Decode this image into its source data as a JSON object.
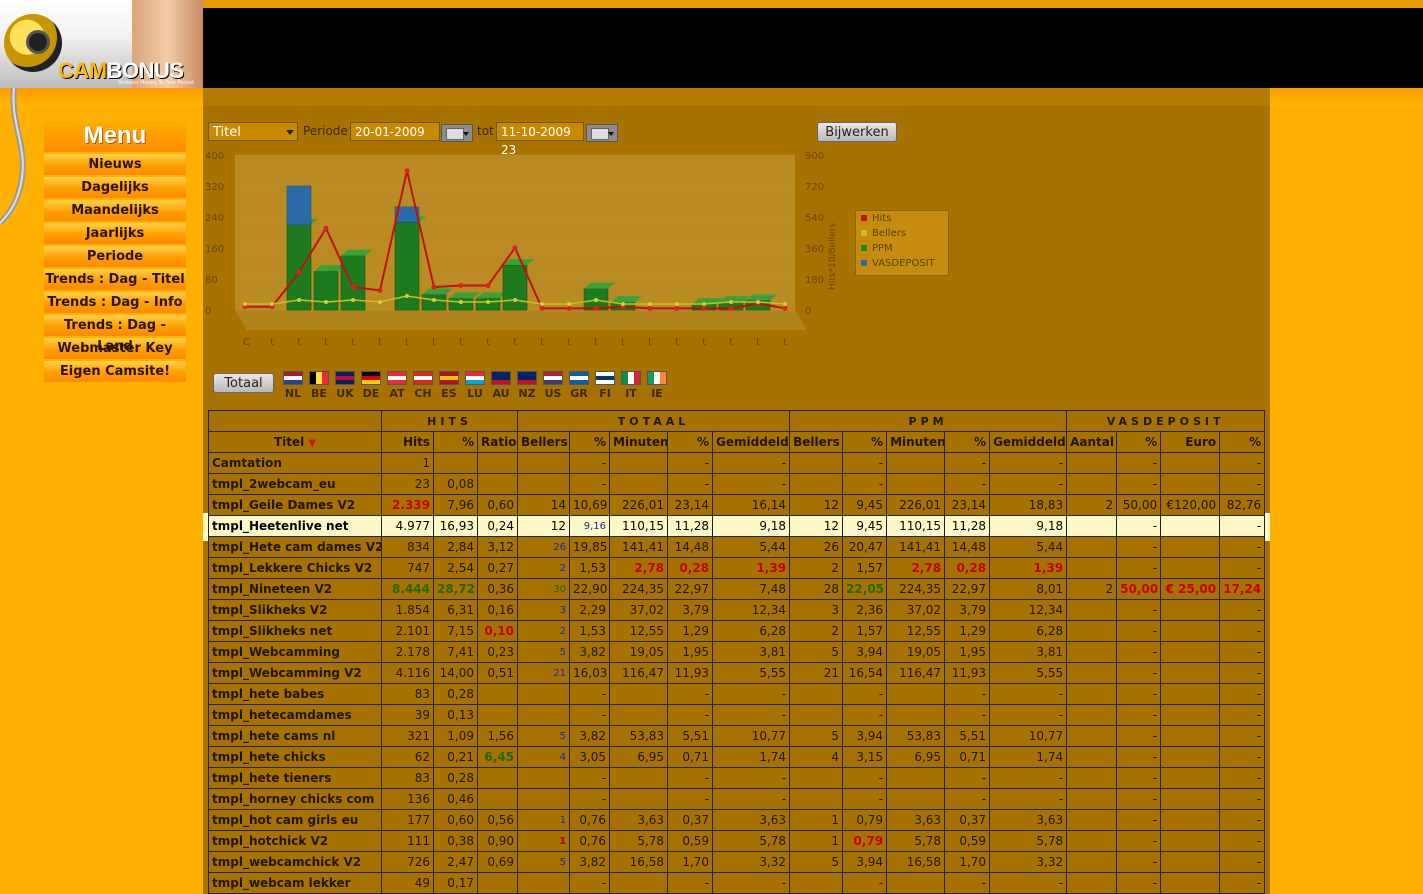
{
  "logo": {
    "brand_a": "CAM",
    "brand_b": "BONUS",
    "tagline": "Streams Money To Your Pocket"
  },
  "menu": {
    "title": "Menu",
    "items": [
      {
        "label": "Nieuws"
      },
      {
        "label": "Dagelijks"
      },
      {
        "label": "Maandelijks"
      },
      {
        "label": "Jaarlijks"
      },
      {
        "label": "Periode"
      },
      {
        "label": "Trends : Dag - Titel"
      },
      {
        "label": "Trends : Dag - Info"
      },
      {
        "label": "Trends : Dag - Land"
      },
      {
        "label": "Webmaster Key"
      },
      {
        "label": "Eigen Camsite!"
      }
    ]
  },
  "filters": {
    "select_value": "Titel",
    "periode_label": "Periode",
    "from_value": "20-01-2009",
    "tot_label": "tot",
    "to_value": "11-10-2009 23",
    "update_label": "Bijwerken",
    "total_label": "Totaal"
  },
  "colors": {
    "hits": "#C01010",
    "bellers": "#C8C020",
    "ppm": "#1E8A1E",
    "vasdeposit": "#2A6AA8"
  },
  "chart_data": {
    "type": "bar",
    "left_ticks": [
      "400",
      "320",
      "240",
      "160",
      "80",
      "0"
    ],
    "right_ticks": [
      "900",
      "720",
      "540",
      "360",
      "180",
      "0"
    ],
    "right_axis_label": "Hits*10/Bellers",
    "x_labels": [
      "C",
      "t",
      "t",
      "t",
      "t",
      "t",
      "t",
      "t",
      "t",
      "t",
      "t",
      "t",
      "t",
      "t",
      "t",
      "t",
      "t",
      "t",
      "t",
      "t",
      "t"
    ],
    "legend": [
      "Hits",
      "Bellers",
      "PPM",
      "VASDEPOSIT"
    ],
    "hits_line": [
      2,
      2,
      23,
      50,
      14,
      12,
      85,
      14,
      15,
      15,
      38,
      1,
      1,
      1,
      2,
      1,
      1,
      1,
      1,
      4,
      1
    ],
    "bellers_line": [
      0,
      0,
      2,
      1,
      2,
      1,
      4,
      2,
      1,
      1,
      2,
      0,
      0,
      2,
      0,
      0,
      0,
      0,
      1,
      1,
      0
    ],
    "ppm_bars": [
      0,
      0,
      220,
      100,
      140,
      0,
      226,
      40,
      30,
      30,
      116,
      0,
      0,
      55,
      20,
      0,
      0,
      15,
      20,
      25,
      0
    ],
    "vas_bars": [
      0,
      0,
      100,
      0,
      0,
      0,
      40,
      0,
      0,
      0,
      0,
      0,
      0,
      0,
      0,
      0,
      0,
      0,
      0,
      0,
      0
    ]
  },
  "countries": [
    "NL",
    "BE",
    "UK",
    "DE",
    "AT",
    "CH",
    "ES",
    "LU",
    "AU",
    "NZ",
    "US",
    "GR",
    "FI",
    "IT",
    "IE"
  ],
  "table": {
    "groups": [
      "HITS",
      "TOTAAL",
      "PPM",
      "VASDEPOSIT"
    ],
    "titel_header": "Titel",
    "columns": [
      "Hits",
      "%",
      "Ratio",
      "Bellers",
      "%",
      "Minuten",
      "%",
      "Gemiddeld",
      "Bellers",
      "%",
      "Minuten",
      "%",
      "Gemiddeld",
      "Aantal",
      "%",
      "Euro",
      "%"
    ],
    "rows": [
      {
        "name": "Camtation",
        "c": [
          "1",
          "",
          "",
          "",
          "-",
          "",
          "-",
          "-",
          "",
          "-",
          "",
          "-",
          "-",
          "",
          "-",
          "",
          "-"
        ]
      },
      {
        "name": "tmpl_2webcam_eu",
        "c": [
          "23",
          "0,08",
          "",
          "",
          "-",
          "",
          "-",
          "-",
          "",
          "-",
          "",
          "-",
          "-",
          "",
          "-",
          "",
          "-"
        ]
      },
      {
        "name": "tmpl_Geile Dames V2",
        "c": [
          "2.339",
          "7,96",
          "0,60",
          "14",
          "10,69",
          "226,01",
          "23,14",
          "16,14",
          "12",
          "9,45",
          "226,01",
          "23,14",
          "18,83",
          "2",
          "50,00",
          "€120,00",
          "82,76"
        ]
      },
      {
        "name": "tmpl_Heetenlive net",
        "c": [
          "4.977",
          "16,93",
          "0,24",
          "12",
          "9,16",
          "110,15",
          "11,28",
          "9,18",
          "12",
          "9,45",
          "110,15",
          "11,28",
          "9,18",
          "",
          "-",
          "",
          "-"
        ]
      },
      {
        "name": "tmpl_Hete cam dames V2",
        "c": [
          "834",
          "2,84",
          "3,12",
          "26",
          "19,85",
          "141,41",
          "14,48",
          "5,44",
          "26",
          "20,47",
          "141,41",
          "14,48",
          "5,44",
          "",
          "-",
          "",
          "-"
        ]
      },
      {
        "name": "tmpl_Lekkere Chicks V2",
        "c": [
          "747",
          "2,54",
          "0,27",
          "2",
          "1,53",
          "2,78",
          "0,28",
          "1,39",
          "2",
          "1,57",
          "2,78",
          "0,28",
          "1,39",
          "",
          "-",
          "",
          "-"
        ]
      },
      {
        "name": "tmpl_Nineteen V2",
        "c": [
          "8.444",
          "28,72",
          "0,36",
          "30",
          "22,90",
          "224,35",
          "22,97",
          "7,48",
          "28",
          "22,05",
          "224,35",
          "22,97",
          "8,01",
          "2",
          "50,00",
          "€  25,00",
          "17,24"
        ]
      },
      {
        "name": "tmpl_Slikheks V2",
        "c": [
          "1.854",
          "6,31",
          "0,16",
          "3",
          "2,29",
          "37,02",
          "3,79",
          "12,34",
          "3",
          "2,36",
          "37,02",
          "3,79",
          "12,34",
          "",
          "-",
          "",
          "-"
        ]
      },
      {
        "name": "tmpl_Slikheks net",
        "c": [
          "2.101",
          "7,15",
          "0,10",
          "2",
          "1,53",
          "12,55",
          "1,29",
          "6,28",
          "2",
          "1,57",
          "12,55",
          "1,29",
          "6,28",
          "",
          "-",
          "",
          "-"
        ]
      },
      {
        "name": "tmpl_Webcamming",
        "c": [
          "2.178",
          "7,41",
          "0,23",
          "5",
          "3,82",
          "19,05",
          "1,95",
          "3,81",
          "5",
          "3,94",
          "19,05",
          "1,95",
          "3,81",
          "",
          "-",
          "",
          "-"
        ]
      },
      {
        "name": "tmpl_Webcamming V2",
        "c": [
          "4.116",
          "14,00",
          "0,51",
          "21",
          "16,03",
          "116,47",
          "11,93",
          "5,55",
          "21",
          "16,54",
          "116,47",
          "11,93",
          "5,55",
          "",
          "-",
          "",
          "-"
        ]
      },
      {
        "name": "tmpl_hete babes",
        "c": [
          "83",
          "0,28",
          "",
          "",
          "-",
          "",
          "-",
          "-",
          "",
          "-",
          "",
          "-",
          "-",
          "",
          "-",
          "",
          "-"
        ]
      },
      {
        "name": "tmpl_hetecamdames",
        "c": [
          "39",
          "0,13",
          "",
          "",
          "-",
          "",
          "-",
          "-",
          "",
          "-",
          "",
          "-",
          "-",
          "",
          "-",
          "",
          "-"
        ]
      },
      {
        "name": "tmpl_hete cams nl",
        "c": [
          "321",
          "1,09",
          "1,56",
          "5",
          "3,82",
          "53,83",
          "5,51",
          "10,77",
          "5",
          "3,94",
          "53,83",
          "5,51",
          "10,77",
          "",
          "-",
          "",
          "-"
        ]
      },
      {
        "name": "tmpl_hete chicks",
        "c": [
          "62",
          "0,21",
          "6,45",
          "4",
          "3,05",
          "6,95",
          "0,71",
          "1,74",
          "4",
          "3,15",
          "6,95",
          "0,71",
          "1,74",
          "",
          "-",
          "",
          "-"
        ]
      },
      {
        "name": "tmpl_hete tieners",
        "c": [
          "83",
          "0,28",
          "",
          "",
          "-",
          "",
          "-",
          "-",
          "",
          "-",
          "",
          "-",
          "-",
          "",
          "-",
          "",
          "-"
        ]
      },
      {
        "name": "tmpl_horney chicks com",
        "c": [
          "136",
          "0,46",
          "",
          "",
          "-",
          "",
          "-",
          "-",
          "",
          "-",
          "",
          "-",
          "-",
          "",
          "-",
          "",
          "-"
        ]
      },
      {
        "name": "tmpl_hot cam girls eu",
        "c": [
          "177",
          "0,60",
          "0,56",
          "1",
          "0,76",
          "3,63",
          "0,37",
          "3,63",
          "1",
          "0,79",
          "3,63",
          "0,37",
          "3,63",
          "",
          "-",
          "",
          "-"
        ]
      },
      {
        "name": "tmpl_hotchick V2",
        "c": [
          "111",
          "0,38",
          "0,90",
          "1",
          "0,76",
          "5,78",
          "0,59",
          "5,78",
          "1",
          "0,79",
          "5,78",
          "0,59",
          "5,78",
          "",
          "-",
          "",
          "-"
        ]
      },
      {
        "name": "tmpl_webcamchick V2",
        "c": [
          "726",
          "2,47",
          "0,69",
          "5",
          "3,82",
          "16,58",
          "1,70",
          "3,32",
          "5",
          "3,94",
          "16,58",
          "1,70",
          "3,32",
          "",
          "-",
          "",
          "-"
        ]
      },
      {
        "name": "tmpl_webcam lekker",
        "c": [
          "49",
          "0,17",
          "",
          "",
          "-",
          "",
          "-",
          "-",
          "",
          "-",
          "",
          "-",
          "-",
          "",
          "-",
          "",
          "-"
        ]
      }
    ]
  }
}
